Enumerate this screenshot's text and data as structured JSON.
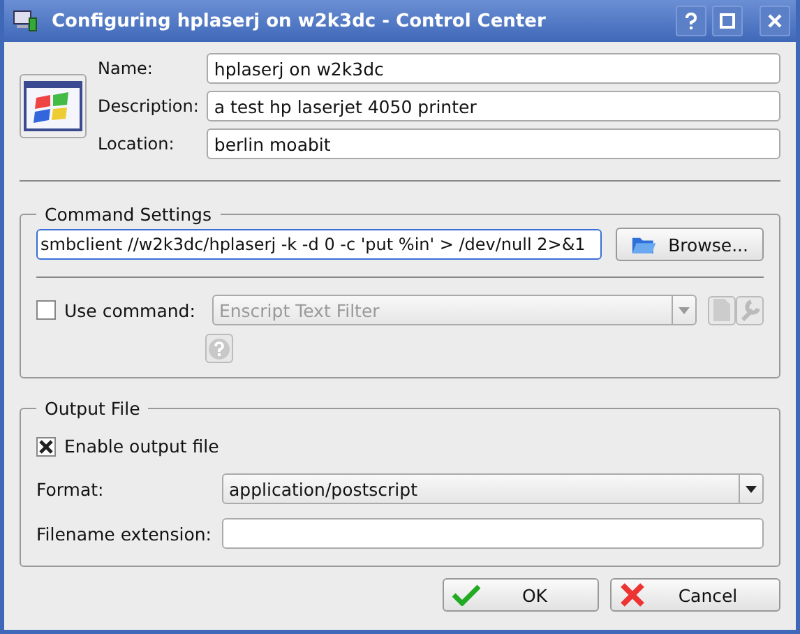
{
  "window": {
    "title": "Configuring hplaserj on w2k3dc - Control Center"
  },
  "fields": [
    {
      "label": "Name:",
      "value": "hplaserj on w2k3dc"
    },
    {
      "label": "Description:",
      "value": "a test hp laserjet 4050 printer"
    },
    {
      "label": "Location:",
      "value": "berlin moabit"
    }
  ],
  "command_settings": {
    "title": "Command Settings",
    "command": "smbclient //w2k3dc/hplaserj -k -d 0 -c 'put %in' > /dev/null 2>&1",
    "browse_button": "Browse...",
    "use_command": {
      "label": "Use command:",
      "checked": false
    },
    "filter": "Enscript Text Filter"
  },
  "output_file": {
    "title": "Output File",
    "enable": {
      "label": "Enable output file",
      "checked": true
    },
    "format_label": "Format:",
    "format": "application/postscript",
    "extension_label": "Filename extension:"
  },
  "buttons": [
    {
      "kind": "ok",
      "label": "OK"
    },
    {
      "kind": "cancel",
      "label": "Cancel"
    }
  ]
}
